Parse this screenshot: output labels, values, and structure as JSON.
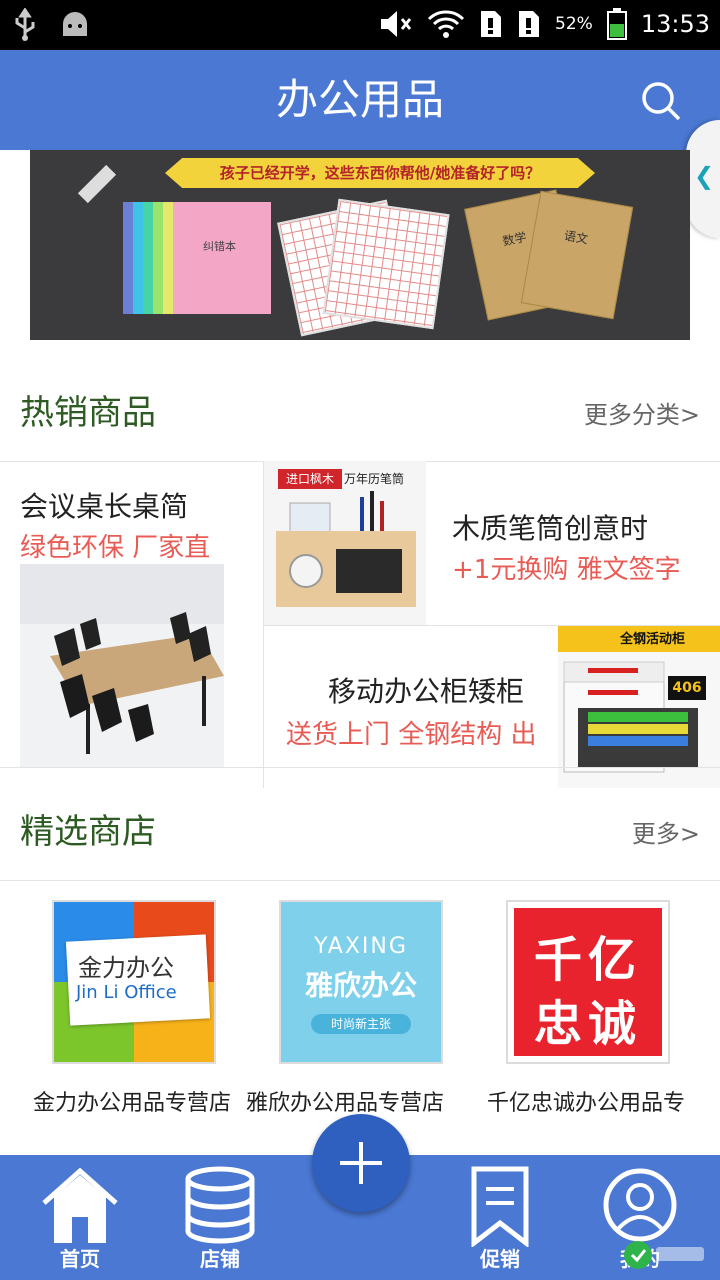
{
  "status_bar": {
    "battery": "52%",
    "time": "13:53"
  },
  "header": {
    "title": "办公用品"
  },
  "banner": {
    "ribbon": "孩子已经开学，这些东西你帮他/她准备好了吗？",
    "notebook_text": "纠错本",
    "kraft_labels": [
      "数学",
      "语文"
    ]
  },
  "hot": {
    "title": "热销商品",
    "more": "更多分类>",
    "items": [
      {
        "name": "会议桌长桌简",
        "subtitle": "绿色环保 厂家直"
      },
      {
        "name": "木质笔筒创意时",
        "subtitle": "+1元换购 雅文签字",
        "tag1": "进口枫木",
        "tag2": "万年历笔筒"
      },
      {
        "name": "移动办公柜矮柜",
        "subtitle": "送货上门 全钢结构 出",
        "tag1": "全钢活动柜",
        "tag2": "406"
      }
    ]
  },
  "shops": {
    "title": "精选商店",
    "more": "更多>",
    "items": [
      {
        "name": "金力办公用品专营店",
        "logo_line1": "金力办公",
        "logo_line2": "Jin Li Office"
      },
      {
        "name": "雅欣办公用品专营店",
        "logo_line1": "YAXING",
        "logo_line2": "雅欣办公",
        "logo_line3": "时尚新主张"
      },
      {
        "name": "千亿忠诚办公用品专",
        "logo_line1": "千亿",
        "logo_line2": "忠诚"
      }
    ]
  },
  "nav": {
    "home": "首页",
    "shops": "店铺",
    "promo": "促销",
    "mine": "我的"
  }
}
